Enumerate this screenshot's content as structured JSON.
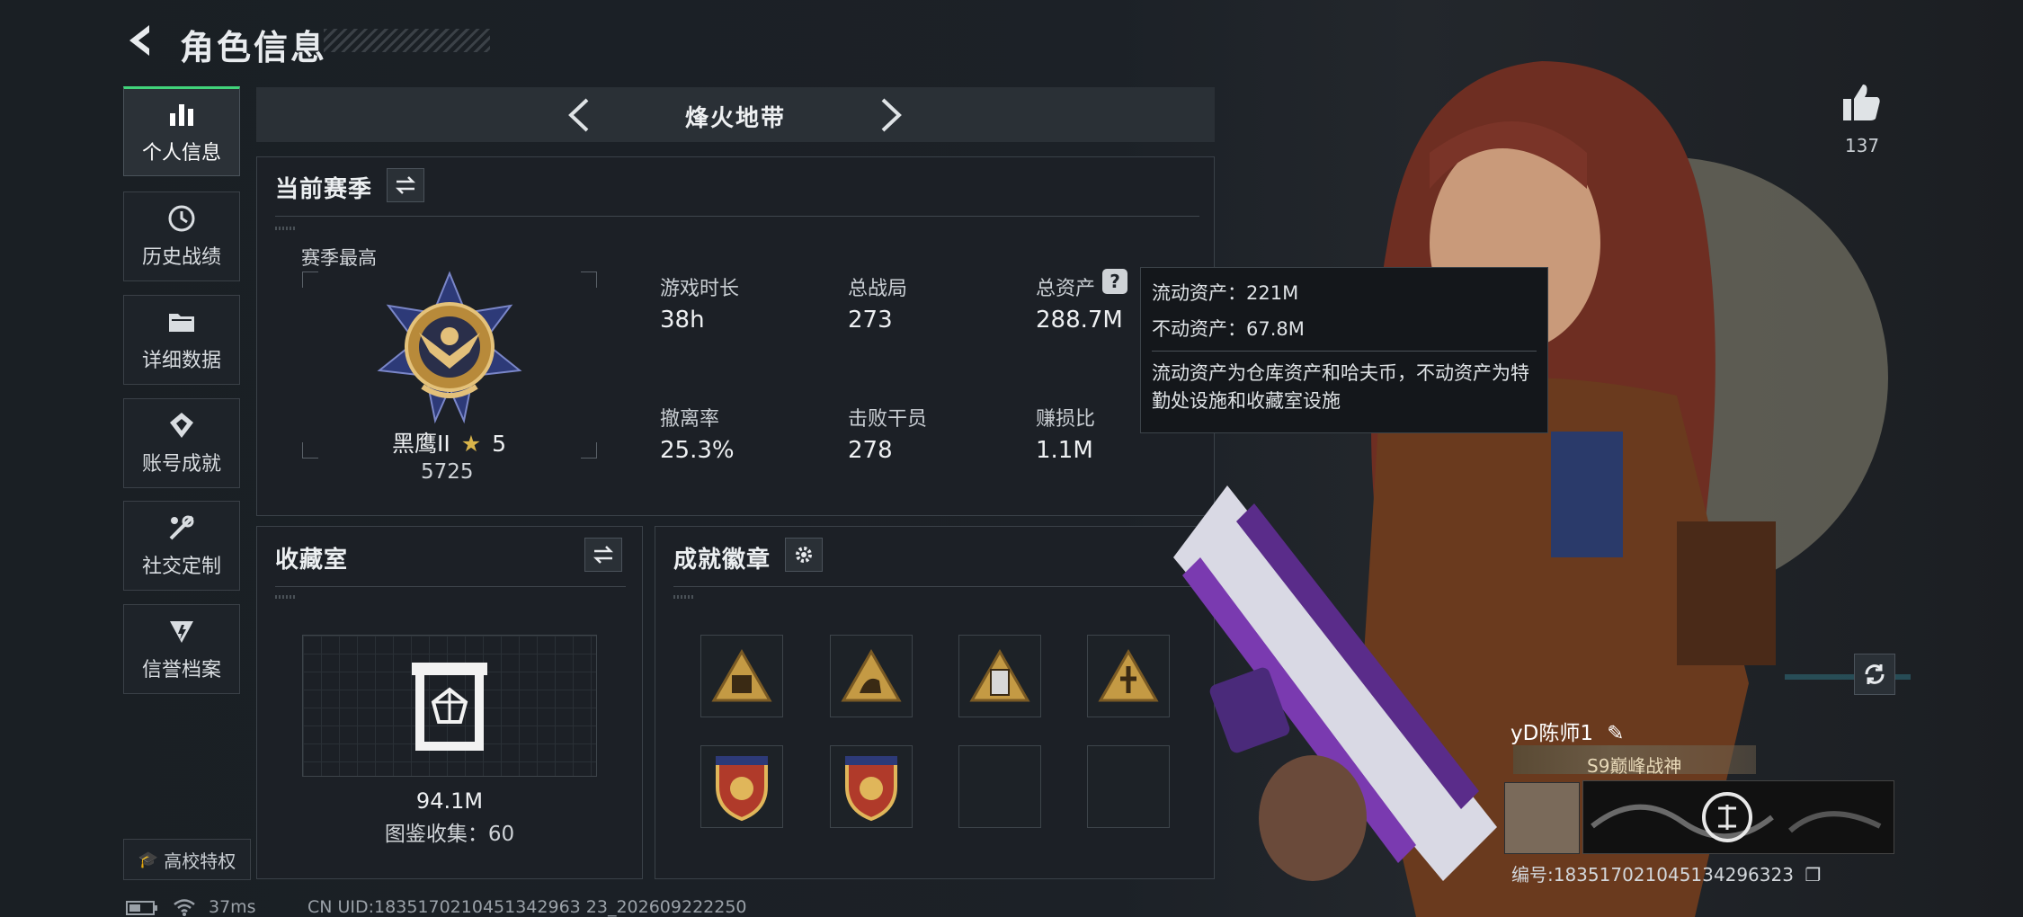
{
  "header": {
    "title": "角色信息"
  },
  "sidebar": {
    "items": [
      {
        "label": "个人信息",
        "icon": "bar-chart-icon",
        "active": true
      },
      {
        "label": "历史战绩",
        "icon": "history-icon"
      },
      {
        "label": "详细数据",
        "icon": "folder-icon"
      },
      {
        "label": "账号成就",
        "icon": "achievement-icon"
      },
      {
        "label": "社交定制",
        "icon": "tools-icon"
      },
      {
        "label": "信誉档案",
        "icon": "shield-icon"
      }
    ],
    "edu_label": "高校特权"
  },
  "map": {
    "name": "烽火地带"
  },
  "season": {
    "title": "当前赛季",
    "best_label": "赛季最高",
    "rank_name": "黑鹰II",
    "rank_stars": "5",
    "rank_score": "5725",
    "stats": [
      {
        "label": "游戏时长",
        "value": "38h"
      },
      {
        "label": "总战局",
        "value": "273"
      },
      {
        "label": "总资产",
        "value": "288.7M"
      },
      {
        "label": "撤离率",
        "value": "25.3%"
      },
      {
        "label": "击败干员",
        "value": "278"
      },
      {
        "label": "赚损比",
        "value": "1.1M"
      }
    ]
  },
  "tooltip": {
    "liquid": "流动资产：221M",
    "fixed": "不动资产：67.8M",
    "note": "流动资产为仓库资产和哈夫币，不动资产为特勤处设施和收藏室设施"
  },
  "collection": {
    "title": "收藏室",
    "value": "94.1M",
    "count": "图鉴收集：60"
  },
  "badges": {
    "title": "成就徽章"
  },
  "profile": {
    "likes": "137",
    "name": "yD陈师1",
    "title": "S9巅峰战神",
    "uid": "编号:1835170210451342963​23"
  },
  "status_bar": {
    "ping": "37ms",
    "uid": "CN UID:1835170210451342963 23_202609222250"
  },
  "colors": {
    "accent": "#41d37a",
    "panel_bg": "#1c2126",
    "text": "#eef0f2"
  }
}
